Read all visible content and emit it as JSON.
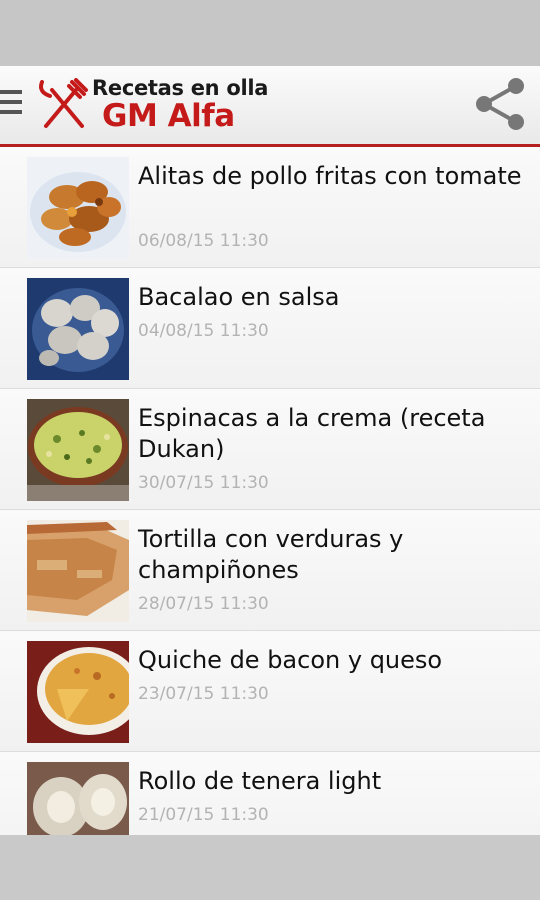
{
  "header": {
    "logo_line1": "Recetas en olla",
    "logo_line2": "GM Alfa",
    "menu_icon": "hamburger-menu-icon",
    "share_icon": "share-icon",
    "logo_icon": "fork-knife-icon",
    "accent_color": "#b51f1f"
  },
  "recipes": [
    {
      "title": "Alitas de pollo fritas con tomate",
      "date": "06/08/15 11:30"
    },
    {
      "title": "Bacalao en salsa",
      "date": "04/08/15 11:30"
    },
    {
      "title": "Espinacas a la crema (receta Dukan)",
      "date": "30/07/15 11:30"
    },
    {
      "title": "Tortilla con verduras y champiñones",
      "date": "28/07/15 11:30"
    },
    {
      "title": "Quiche de bacon y queso",
      "date": "23/07/15 11:30"
    },
    {
      "title": "Rollo de tenera light",
      "date": "21/07/15 11:30"
    }
  ]
}
